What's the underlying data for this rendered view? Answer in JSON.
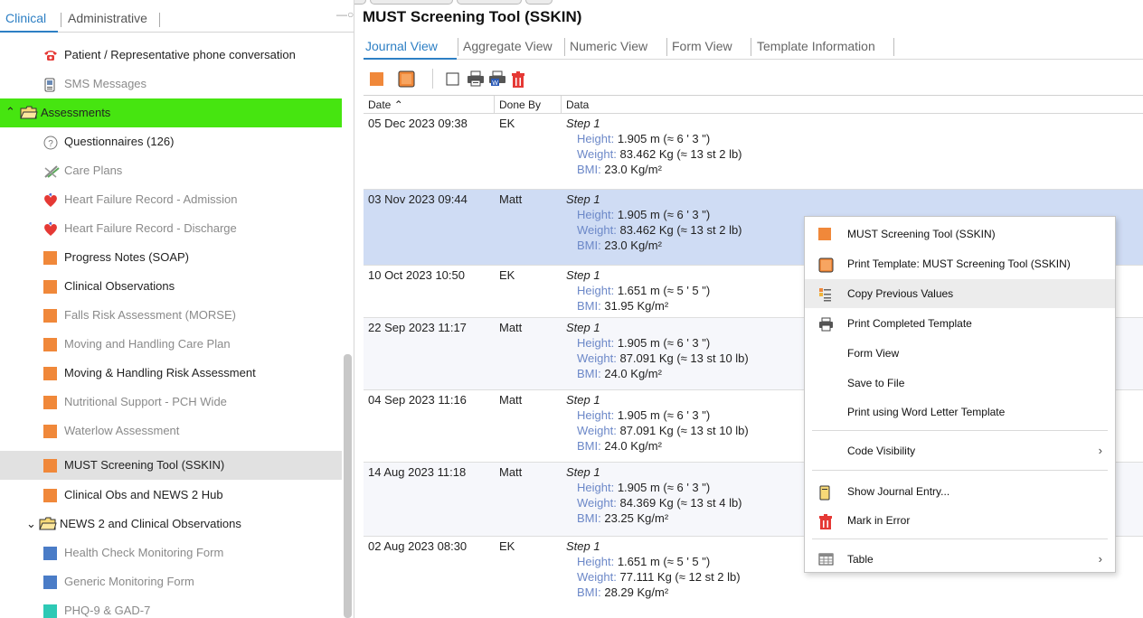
{
  "left_tabs": {
    "clinical": "Clinical",
    "administrative": "Administrative"
  },
  "tree": {
    "items": [
      {
        "label": "Patient / Representative phone conversation",
        "icon": "phone-icon"
      },
      {
        "label": "SMS Messages",
        "icon": "sms-icon"
      },
      {
        "label": "Assessments",
        "icon": "folder-open-icon"
      },
      {
        "label": "Questionnaires (126)",
        "icon": "question-icon"
      },
      {
        "label": "Care Plans",
        "icon": "care-plan-icon"
      },
      {
        "label": "Heart Failure Record - Admission",
        "icon": "heart-icon"
      },
      {
        "label": "Heart Failure Record - Discharge",
        "icon": "heart-icon"
      },
      {
        "label": "Progress Notes (SOAP)",
        "icon": "template-icon"
      },
      {
        "label": "Clinical Observations",
        "icon": "template-icon"
      },
      {
        "label": "Falls Risk Assessment (MORSE)",
        "icon": "template-icon"
      },
      {
        "label": "Moving and Handling Care Plan",
        "icon": "template-icon"
      },
      {
        "label": "Moving & Handling Risk Assessment",
        "icon": "template-icon"
      },
      {
        "label": "Nutritional Support - PCH Wide",
        "icon": "template-icon"
      },
      {
        "label": "Waterlow Assessment",
        "icon": "template-icon"
      },
      {
        "label": "MUST Screening Tool (SSKIN)",
        "icon": "template-icon"
      },
      {
        "label": "Clinical Obs and NEWS 2 Hub",
        "icon": "template-icon"
      },
      {
        "label": "NEWS 2 and Clinical Observations",
        "icon": "folder-icon"
      },
      {
        "label": "Health Check Monitoring Form",
        "icon": "template-blue-icon"
      },
      {
        "label": "Generic Monitoring Form",
        "icon": "template-blue-icon"
      },
      {
        "label": "PHQ-9 & GAD-7",
        "icon": "template-teal-icon"
      }
    ]
  },
  "main": {
    "title": "MUST Screening Tool (SSKIN)",
    "tabs": [
      "Journal View",
      "Aggregate View",
      "Numeric View",
      "Form View",
      "Template Information"
    ],
    "columns": [
      "Date",
      "Done By",
      "Data"
    ],
    "rows": [
      {
        "date": "05 Dec 2023 09:38",
        "by": "EK",
        "step": "Step 1",
        "lines": [
          {
            "key": "Height:",
            "val": "1.905 m  (≈ 6 ' 3 \")"
          },
          {
            "key": "Weight:",
            "val": "83.462 Kg  (≈ 13 st 2 lb)"
          },
          {
            "key": "BMI:",
            "val": "23.0 Kg/m²"
          }
        ]
      },
      {
        "date": "03 Nov 2023 09:44",
        "by": "Matt",
        "step": "Step 1",
        "lines": [
          {
            "key": "Height:",
            "val": "1.905 m  (≈ 6 ' 3 \")"
          },
          {
            "key": "Weight:",
            "val": "83.462 Kg  (≈ 13 st 2 lb)"
          },
          {
            "key": "BMI:",
            "val": "23.0 Kg/m²"
          }
        ]
      },
      {
        "date": "10 Oct 2023 10:50",
        "by": "EK",
        "step": "Step 1",
        "lines": [
          {
            "key": "Height:",
            "val": "1.651 m  (≈ 5 ' 5 \")"
          },
          {
            "key": "BMI:",
            "val": "31.95 Kg/m²"
          }
        ]
      },
      {
        "date": "22 Sep 2023 11:17",
        "by": "Matt",
        "step": "Step 1",
        "lines": [
          {
            "key": "Height:",
            "val": "1.905 m  (≈ 6 ' 3 \")"
          },
          {
            "key": "Weight:",
            "val": "87.091 Kg  (≈ 13 st 10 lb)"
          },
          {
            "key": "BMI:",
            "val": "24.0 Kg/m²"
          }
        ]
      },
      {
        "date": "04 Sep 2023 11:16",
        "by": "Matt",
        "step": "Step 1",
        "lines": [
          {
            "key": "Height:",
            "val": "1.905 m  (≈ 6 ' 3 \")"
          },
          {
            "key": "Weight:",
            "val": "87.091 Kg  (≈ 13 st 10 lb)"
          },
          {
            "key": "BMI:",
            "val": "24.0 Kg/m²"
          }
        ]
      },
      {
        "date": "14 Aug 2023 11:18",
        "by": "Matt",
        "step": "Step 1",
        "lines": [
          {
            "key": "Height:",
            "val": "1.905 m  (≈ 6 ' 3 \")"
          },
          {
            "key": "Weight:",
            "val": "84.369 Kg  (≈ 13 st 4 lb)"
          },
          {
            "key": "BMI:",
            "val": "23.25 Kg/m²"
          }
        ]
      },
      {
        "date": "02 Aug 2023 08:30",
        "by": "EK",
        "step": "Step 1",
        "lines": [
          {
            "key": "Height:",
            "val": "1.651 m  (≈ 5 ' 5 \")"
          },
          {
            "key": "Weight:",
            "val": "77.111 Kg  (≈ 12 st 2 lb)"
          },
          {
            "key": "BMI:",
            "val": "28.29 Kg/m²"
          }
        ]
      }
    ]
  },
  "context_menu": {
    "items": [
      {
        "label": "MUST Screening Tool (SSKIN)",
        "icon": "template-icon"
      },
      {
        "label": "Print Template: MUST Screening Tool (SSKIN)",
        "icon": "print-template-icon"
      },
      {
        "label": "Copy Previous Values",
        "icon": "copy-values-icon"
      },
      {
        "label": "Print Completed Template",
        "icon": "printer-icon"
      },
      {
        "label": "Form View",
        "icon": ""
      },
      {
        "label": "Save to File",
        "icon": ""
      },
      {
        "label": "Print using Word Letter Template",
        "icon": ""
      },
      {
        "label": "Code Visibility",
        "icon": "",
        "submenu": true
      },
      {
        "label": "Show Journal Entry...",
        "icon": "journal-icon"
      },
      {
        "label": "Mark in Error",
        "icon": "trash-icon"
      },
      {
        "label": "Table",
        "icon": "table-icon",
        "submenu": true
      }
    ],
    "submenu_arrow": "›"
  },
  "colors": {
    "accent": "#2d7fc4",
    "template_orange": "#f0883a",
    "selected_green": "#46e510",
    "row_selected": "#cfdcf4",
    "key_blue": "#6c88c8",
    "error_red": "#e53935"
  }
}
